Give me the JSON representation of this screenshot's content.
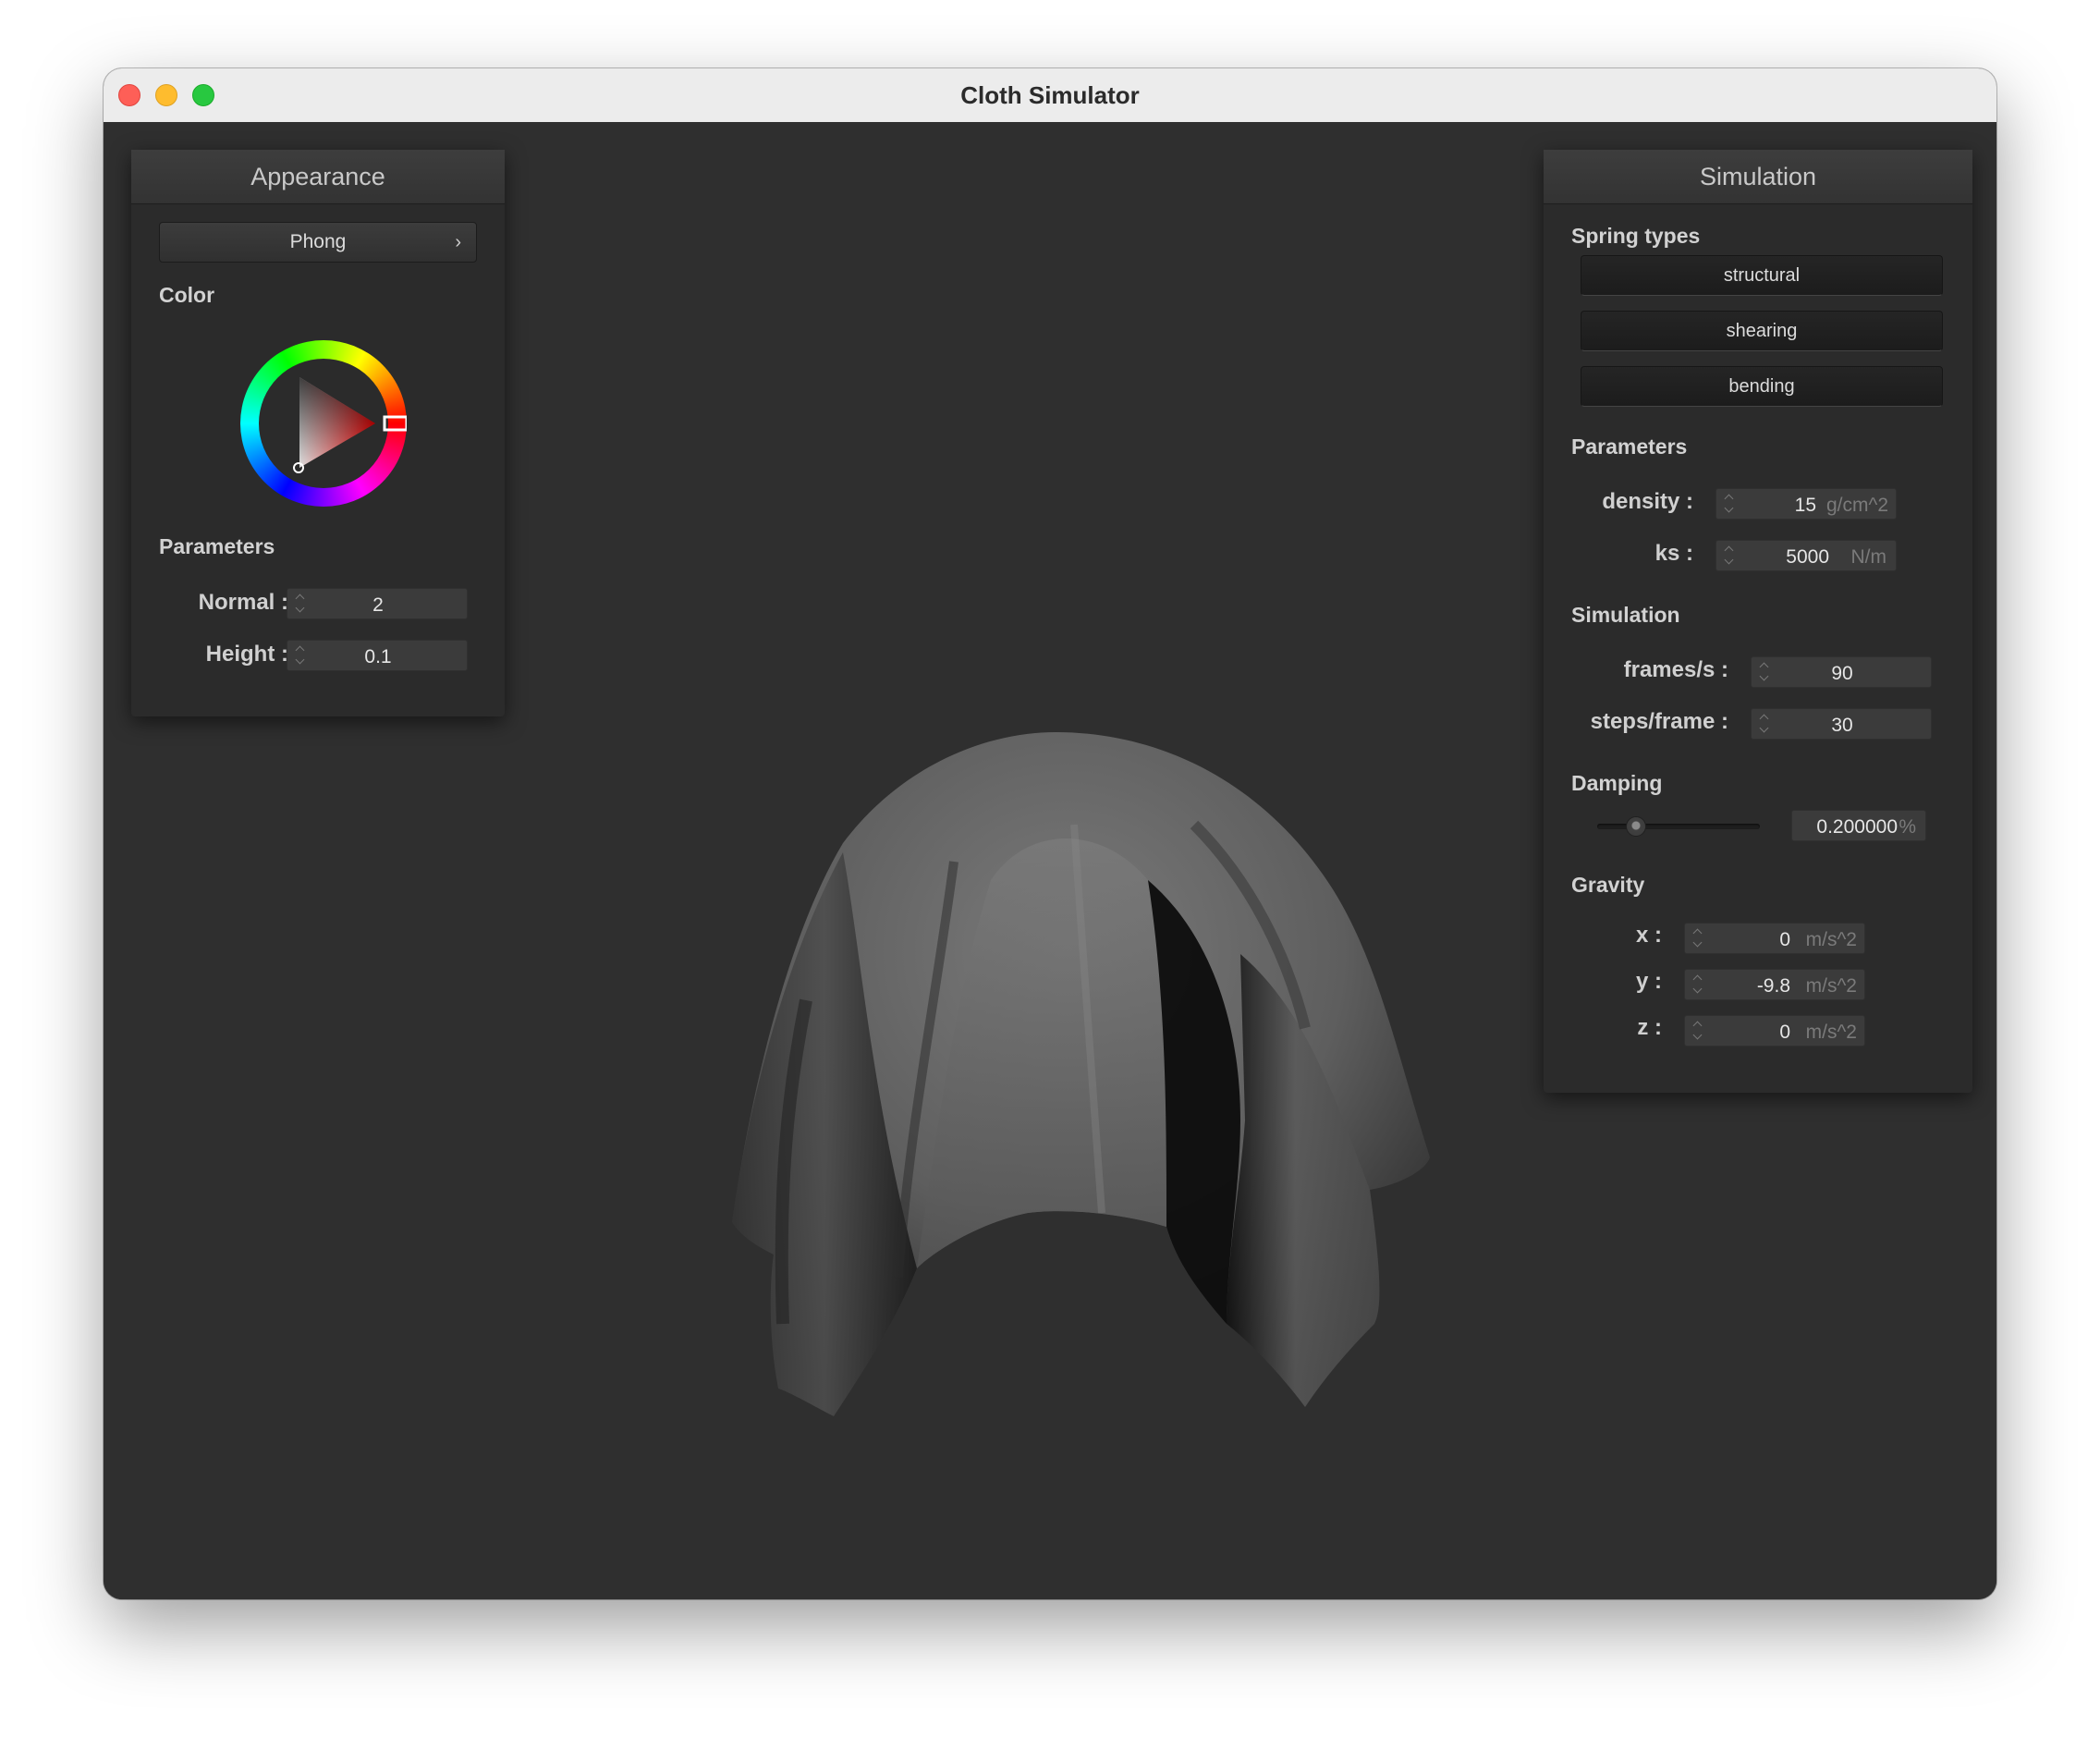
{
  "window": {
    "title": "Cloth Simulator"
  },
  "appearance": {
    "header": "Appearance",
    "shader": "Phong",
    "color_label": "Color",
    "selected_color": "#ff0000",
    "parameters_label": "Parameters",
    "normal_label": "Normal :",
    "normal_value": "2",
    "height_label": "Height :",
    "height_value": "0.1"
  },
  "simulation": {
    "header": "Simulation",
    "spring_types_label": "Spring types",
    "springs": [
      "structural",
      "shearing",
      "bending"
    ],
    "parameters_label": "Parameters",
    "density_label": "density :",
    "density_value": "15",
    "density_unit": "g/cm^2",
    "ks_label": "ks :",
    "ks_value": "5000",
    "ks_unit": "N/m",
    "simulation_label": "Simulation",
    "fps_label": "frames/s :",
    "fps_value": "90",
    "steps_label": "steps/frame :",
    "steps_value": "30",
    "damping_label": "Damping",
    "damping_value": "0.200000",
    "damping_unit": "%",
    "damping_fraction": 0.2,
    "gravity_label": "Gravity",
    "gx_label": "x :",
    "gx_value": "0",
    "gy_label": "y :",
    "gy_value": "-9.8",
    "gz_label": "z :",
    "gz_value": "0",
    "gravity_unit": "m/s^2"
  }
}
